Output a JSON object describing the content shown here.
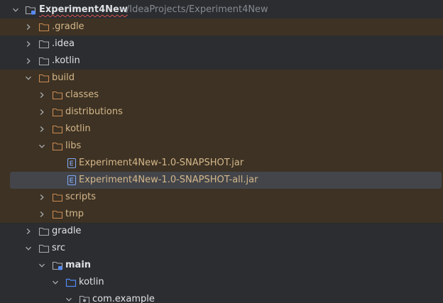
{
  "project": {
    "name": "Experiment4New",
    "path": "~/IdeaProjects/Experiment4New"
  },
  "tree": {
    "gradle_dot": ".gradle",
    "idea": ".idea",
    "kotlin_dot": ".kotlin",
    "build": "build",
    "classes": "classes",
    "distributions": "distributions",
    "kotlin": "kotlin",
    "libs": "libs",
    "jar1": "Experiment4New-1.0-SNAPSHOT.jar",
    "jar2": "Experiment4New-1.0-SNAPSHOT-all.jar",
    "scripts": "scripts",
    "tmp": "tmp",
    "gradle": "gradle",
    "src": "src",
    "main": "main",
    "main_kotlin": "kotlin",
    "package": "com.example"
  },
  "colors": {
    "excluded_bg": "#3d3223",
    "selected_bg": "#43454a",
    "excluded_text": "#d5b78b",
    "text": "#dfe1e5",
    "path_text": "#868a91",
    "folder_blue": "#548af7"
  },
  "icons": {
    "chevron_down": "chevron-down-icon",
    "chevron_right": "chevron-right-icon",
    "folder": "folder-icon",
    "module": "module-folder-icon",
    "source_root": "source-root-folder-icon",
    "package": "package-icon",
    "jar": "jar-file-icon"
  }
}
